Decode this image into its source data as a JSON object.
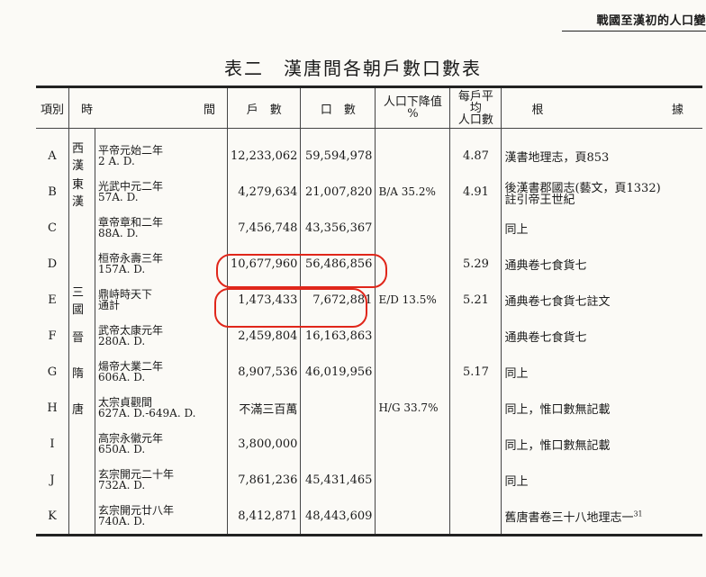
{
  "running_head": "戰國至漢初的人口變",
  "title": "表二　漢唐間各朝戶數口數表",
  "headers": {
    "item": "項別",
    "time_left": "時",
    "time_right": "間",
    "households": "戶　數",
    "population": "口　數",
    "decline_l1": "人口下降值",
    "decline_l2": "%",
    "avg_l1": "每戶平均",
    "avg_l2": "人口數",
    "source_left": "根",
    "source_right": "據"
  },
  "rows": [
    {
      "item": "A",
      "dynasty": "西漢",
      "reign": "平帝元始二年",
      "year": "2 A. D.",
      "households": "12,233,062",
      "population": "59,594,978",
      "decline": "",
      "avg": "4.87",
      "source_l1": "漢書地理志，頁853",
      "source_l2": ""
    },
    {
      "item": "B",
      "dynasty": "東漢",
      "reign": "光武中元二年",
      "year": "57A. D.",
      "households": "4,279,634",
      "population": "21,007,820",
      "decline": "B/A 35.2%",
      "avg": "4.91",
      "source_l1": "後漢書郡國志(藝文，頁1332)",
      "source_l2": "註引帝王世紀"
    },
    {
      "item": "C",
      "dynasty": "",
      "reign": "章帝章和二年",
      "year": "88A. D.",
      "households": "7,456,748",
      "population": "43,356,367",
      "decline": "",
      "avg": "",
      "source_l1": "同上",
      "source_l2": ""
    },
    {
      "item": "D",
      "dynasty": "",
      "reign": "桓帝永壽三年",
      "year": "157A. D.",
      "households": "10,677,960",
      "population": "56,486,856",
      "decline": "",
      "avg": "5.29",
      "source_l1": "通典卷七食貨七",
      "source_l2": ""
    },
    {
      "item": "E",
      "dynasty": "三國",
      "reign": "鼎峙時天下",
      "year": "通計",
      "households": "1,473,433",
      "population": "7,672,881",
      "decline": "E/D 13.5%",
      "avg": "5.21",
      "source_l1": "通典卷七食貨七註文",
      "source_l2": ""
    },
    {
      "item": "F",
      "dynasty": "晉",
      "reign": "武帝太康元年",
      "year": "280A. D.",
      "households": "2,459,804",
      "population": "16,163,863",
      "decline": "",
      "avg": "",
      "source_l1": "通典卷七食貨七",
      "source_l2": ""
    },
    {
      "item": "G",
      "dynasty": "隋",
      "reign": "煬帝大業二年",
      "year": "606A. D.",
      "households": "8,907,536",
      "population": "46,019,956",
      "decline": "",
      "avg": "5.17",
      "source_l1": "同上",
      "source_l2": ""
    },
    {
      "item": "H",
      "dynasty": "唐",
      "reign": "太宗貞觀間",
      "year": "627A. D.-649A. D.",
      "households": "不滿三百萬",
      "population": "",
      "decline": "H/G 33.7%",
      "avg": "",
      "source_l1": "同上，惟口數無記載",
      "source_l2": ""
    },
    {
      "item": "I",
      "dynasty": "",
      "reign": "高宗永徽元年",
      "year": "650A. D.",
      "households": "3,800,000",
      "population": "",
      "decline": "",
      "avg": "",
      "source_l1": "同上，惟口數無記載",
      "source_l2": ""
    },
    {
      "item": "J",
      "dynasty": "",
      "reign": "玄宗開元二十年",
      "year": "732A. D.",
      "households": "7,861,236",
      "population": "45,431,465",
      "decline": "",
      "avg": "",
      "source_l1": "同上",
      "source_l2": ""
    },
    {
      "item": "K",
      "dynasty": "",
      "reign": "玄宗開元廿八年",
      "year": "740A. D.",
      "households": "8,412,871",
      "population": "48,443,609",
      "decline": "",
      "avg": "",
      "source_l1": "舊唐書卷三十八地理志一",
      "source_l2": ""
    }
  ],
  "footnote_mark": "31",
  "annotation_color": "#e0261a"
}
